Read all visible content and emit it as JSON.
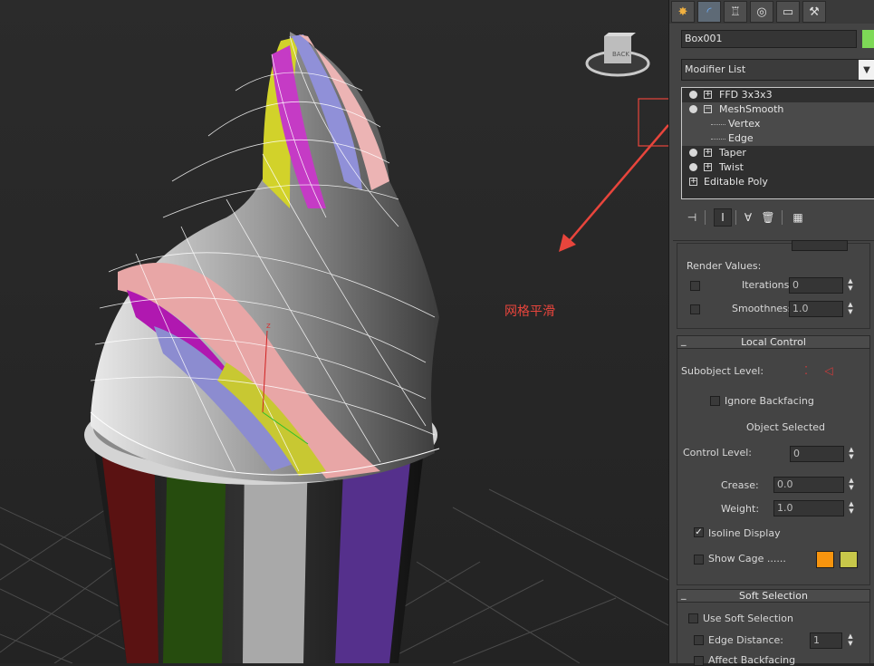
{
  "viewport": {
    "annotation_label": "网格平滑",
    "viewcube_label": "BACK",
    "axis_label": "z"
  },
  "panel": {
    "tabs": [
      {
        "icon": "create-icon",
        "glyph": "✸"
      },
      {
        "icon": "modify-icon",
        "glyph": "◜"
      },
      {
        "icon": "hierarchy-icon",
        "glyph": "♖"
      },
      {
        "icon": "motion-icon",
        "glyph": "◎"
      },
      {
        "icon": "display-icon",
        "glyph": "▭"
      },
      {
        "icon": "utilities-icon",
        "glyph": "⚒"
      }
    ],
    "object_name": "Box001",
    "object_color": "#7ed957",
    "modifier_list_label": "Modifier List",
    "stack": [
      {
        "label": "FFD 3x3x3",
        "has_bulb": true,
        "expand": "+"
      },
      {
        "label": "MeshSmooth",
        "has_bulb": true,
        "expand": "−"
      },
      {
        "label": "Vertex",
        "sub": true
      },
      {
        "label": "Edge",
        "sub": true
      },
      {
        "label": "Taper",
        "has_bulb": true,
        "expand": "+"
      },
      {
        "label": "Twist",
        "has_bulb": true,
        "expand": "+"
      },
      {
        "label": "Editable Poly",
        "has_bulb": false,
        "expand": "+"
      }
    ],
    "stack_toolbar": [
      {
        "icon": "pin-stack-icon",
        "glyph": "⊣"
      },
      {
        "icon": "show-end-result-icon",
        "glyph": "Ⅰ"
      },
      {
        "icon": "make-unique-icon",
        "glyph": "∀"
      },
      {
        "icon": "remove-modifier-icon",
        "glyph": "🗑"
      },
      {
        "icon": "configure-sets-icon",
        "glyph": "▦"
      }
    ],
    "render_values": {
      "title": "Render Values:",
      "iterations_label": "Iterations:",
      "iterations_value": "0",
      "smoothness_label": "Smoothness:",
      "smoothness_value": "1.0"
    },
    "local_control": {
      "title": "Local Control",
      "minimize": "_",
      "subobject_level_label": "Subobject Level:",
      "ignore_backfacing_label": "Ignore Backfacing",
      "object_selected_label": "Object Selected",
      "control_level_label": "Control Level:",
      "control_level_value": "0",
      "crease_label": "Crease:",
      "crease_value": "0.0",
      "weight_label": "Weight:",
      "weight_value": "1.0",
      "isoline_display_label": "Isoline Display",
      "isoline_checked": "✓",
      "show_cage_label": "Show Cage ......",
      "cage_color_1": "#f7940e",
      "cage_color_2": "#c8c84a"
    },
    "soft_selection": {
      "title": "Soft Selection",
      "minimize": "_",
      "use_soft_selection_label": "Use Soft Selection",
      "edge_distance_label": "Edge Distance:",
      "edge_distance_value": "1",
      "affect_backfacing_label": "Affect Backfacing"
    }
  }
}
